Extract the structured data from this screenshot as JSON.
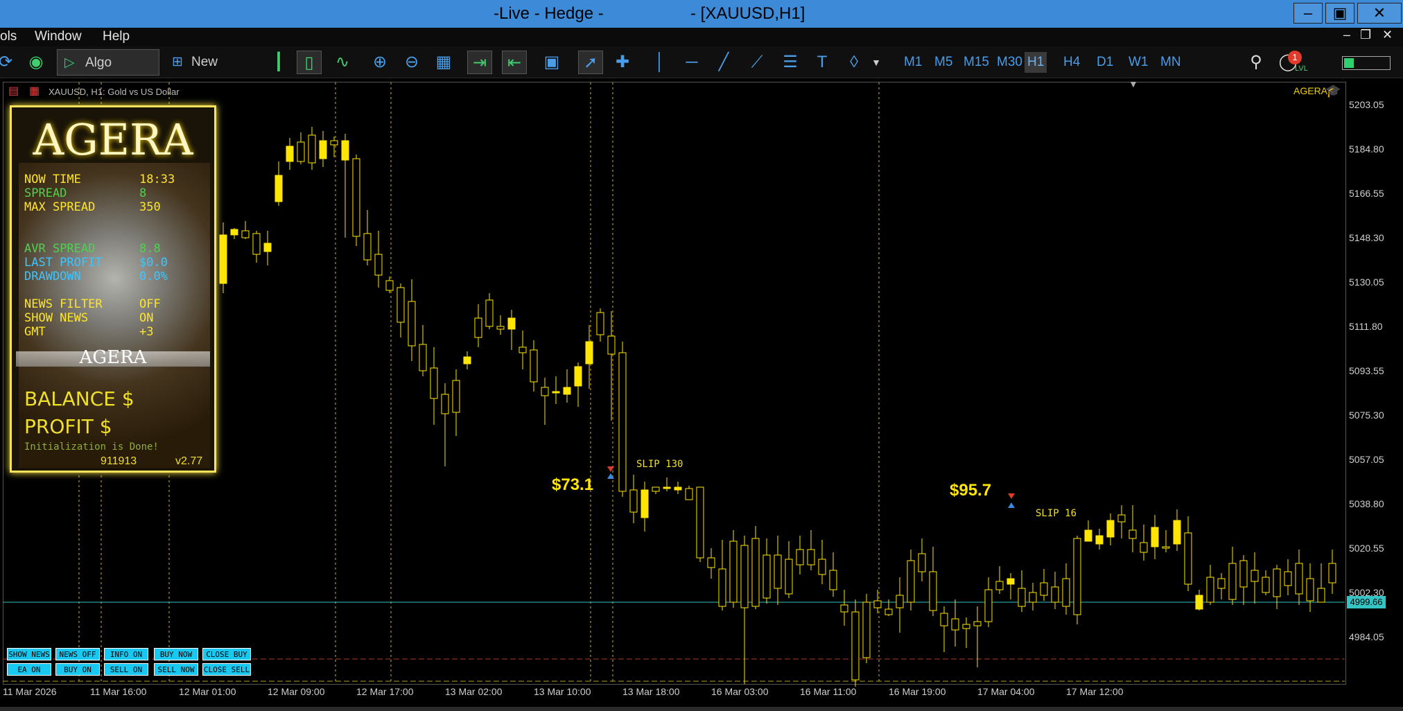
{
  "window": {
    "title_left": "-Live - Hedge -",
    "title_right": "- [XAUUSD,H1]",
    "minimize": "–",
    "maximize": "▣",
    "close": "✕"
  },
  "menu": {
    "items": [
      "ols",
      "Window",
      "Help"
    ]
  },
  "toolbar": {
    "algo_trading": "Algo Trading",
    "new_order": "New Order",
    "timeframes": [
      "M1",
      "M5",
      "M15",
      "M30",
      "H1",
      "H4",
      "D1",
      "W1",
      "MN"
    ],
    "active_timeframe": "H1",
    "notification_count": "1",
    "lvl_label": "LVL"
  },
  "chart": {
    "symbol_label": "XAUUSD, H1:  Gold vs US Dollar",
    "ea_name": "AGERA",
    "current_price": "4999.66",
    "price_labels": [
      "5203.05",
      "5184.80",
      "5166.55",
      "5148.30",
      "5130.05",
      "5111.80",
      "5093.55",
      "5075.30",
      "5057.05",
      "5038.80",
      "5020.55",
      "5002.30",
      "4984.05"
    ],
    "time_labels": [
      "11 Mar 2026",
      "11 Mar 16:00",
      "12 Mar 01:00",
      "12 Mar 09:00",
      "12 Mar 17:00",
      "13 Mar 02:00",
      "13 Mar 10:00",
      "13 Mar 18:00",
      "16 Mar 03:00",
      "16 Mar 11:00",
      "16 Mar 19:00",
      "17 Mar 04:00",
      "17 Mar 12:00"
    ],
    "trades": [
      {
        "profit": "$73.1",
        "slip": "SLIP 130"
      },
      {
        "profit": "$95.7",
        "slip": "SLIP 16"
      }
    ],
    "colors": {
      "candle": "#ffe600",
      "price_line": "#36c3c3",
      "grid_vline": "#d4b52a"
    }
  },
  "panel": {
    "title": "AGERA",
    "rows": [
      {
        "label": "NOW TIME",
        "value": "18:33",
        "color": "yel"
      },
      {
        "label": "SPREAD",
        "value": "8",
        "color": "grn"
      },
      {
        "label": "MAX SPREAD",
        "value": "350",
        "color": "yel"
      },
      {
        "label": "AVR SPREAD",
        "value": "8.8",
        "color": "grn"
      },
      {
        "label": "LAST PROFIT",
        "value": "$0.0",
        "color": "cyn"
      },
      {
        "label": "DRAWDOWN",
        "value": "0.0%",
        "color": "cyn"
      },
      {
        "label": "NEWS  FILTER",
        "value": "OFF",
        "color": "yel"
      },
      {
        "label": "SHOW  NEWS",
        "value": "ON",
        "color": "yel"
      },
      {
        "label": "GMT",
        "value": "+3",
        "color": "yel"
      }
    ],
    "banner": "AGERA",
    "balance_label": "BALANCE $",
    "profit_label": "PROFIT  $",
    "init_msg": "Initialization is Done!",
    "account": "911913",
    "version": "v2.77"
  },
  "buttons_row1": [
    "SHOW NEWS",
    "NEWS OFF",
    "INFO ON",
    "BUY NOW",
    "CLOSE BUY"
  ],
  "buttons_row2": [
    "EA ON",
    "BUY ON",
    "SELL ON",
    "SELL NOW",
    "CLOSE SELL"
  ]
}
